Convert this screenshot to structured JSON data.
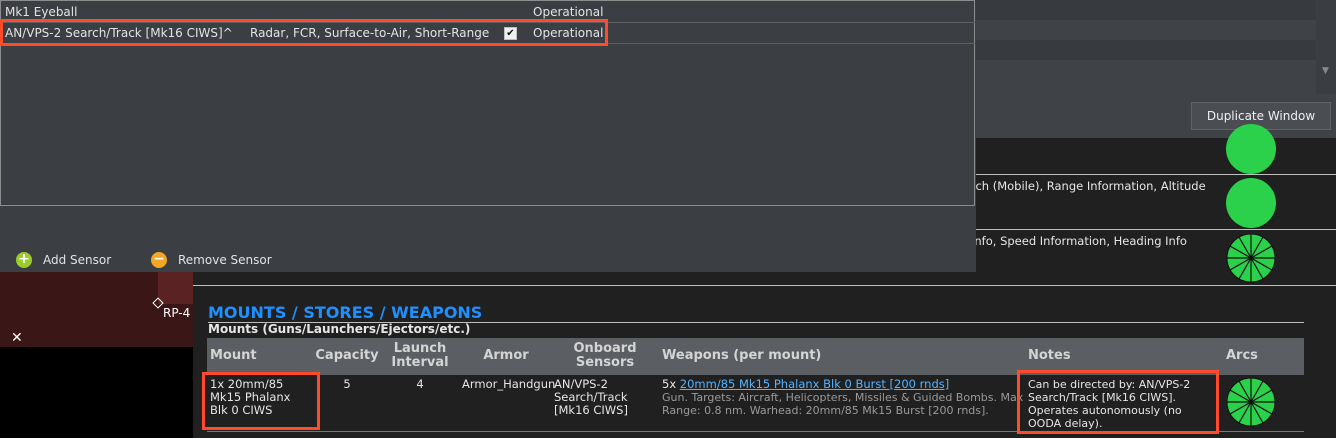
{
  "window": {
    "duplicate_label": "Duplicate Window"
  },
  "sensors_grid": {
    "rows": [
      {
        "name": "Mk1 Eyeball",
        "type": "",
        "checked": false,
        "status": "Operational"
      },
      {
        "name": "AN/VPS-2 Search/Track [Mk16 CIWS]^",
        "type": "Radar, FCR, Surface-to-Air, Short-Range",
        "checked": true,
        "status": "Operational"
      }
    ],
    "add_label": "Add Sensor",
    "remove_label": "Remove Sensor"
  },
  "map": {
    "reference_point": "RP-4"
  },
  "report": {
    "sensor_caps": [
      "rch (Mobile), Range Information, Altitude",
      "Info, Speed Information, Heading Info"
    ],
    "section_title": "MOUNTS / STORES / WEAPONS",
    "mounts_subtitle": "Mounts (Guns/Launchers/Ejectors/etc.)",
    "headers": {
      "mount": "Mount",
      "capacity": "Capacity",
      "launch_interval": "Launch Interval",
      "armor": "Armor",
      "onboard_sensors": "Onboard Sensors",
      "weapons": "Weapons (per mount)",
      "notes": "Notes",
      "arcs": "Arcs"
    },
    "row": {
      "mount": "1x 20mm/85 Mk15 Phalanx Blk 0 CIWS",
      "capacity": "5",
      "launch_interval": "4",
      "armor": "Armor_Handgun",
      "onboard_sensors": "AN/VPS-2 Search/Track [Mk16 CIWS]",
      "weapon_count": "5x",
      "weapon_link": "20mm/85 Mk15 Phalanx Blk 0 Burst [200 rnds]",
      "weapon_detail1": "Gun. Targets: Aircraft, Helicopters, Missiles & Guided Bombs. Max",
      "weapon_detail2": "Range: 0.8 nm. Warhead: 20mm/85 Mk15 Burst [200 rnds].",
      "notes": "Can be directed by: AN/VPS-2 Search/Track [Mk16 CIWS]. Operates autonomously (no OODA delay)."
    }
  }
}
